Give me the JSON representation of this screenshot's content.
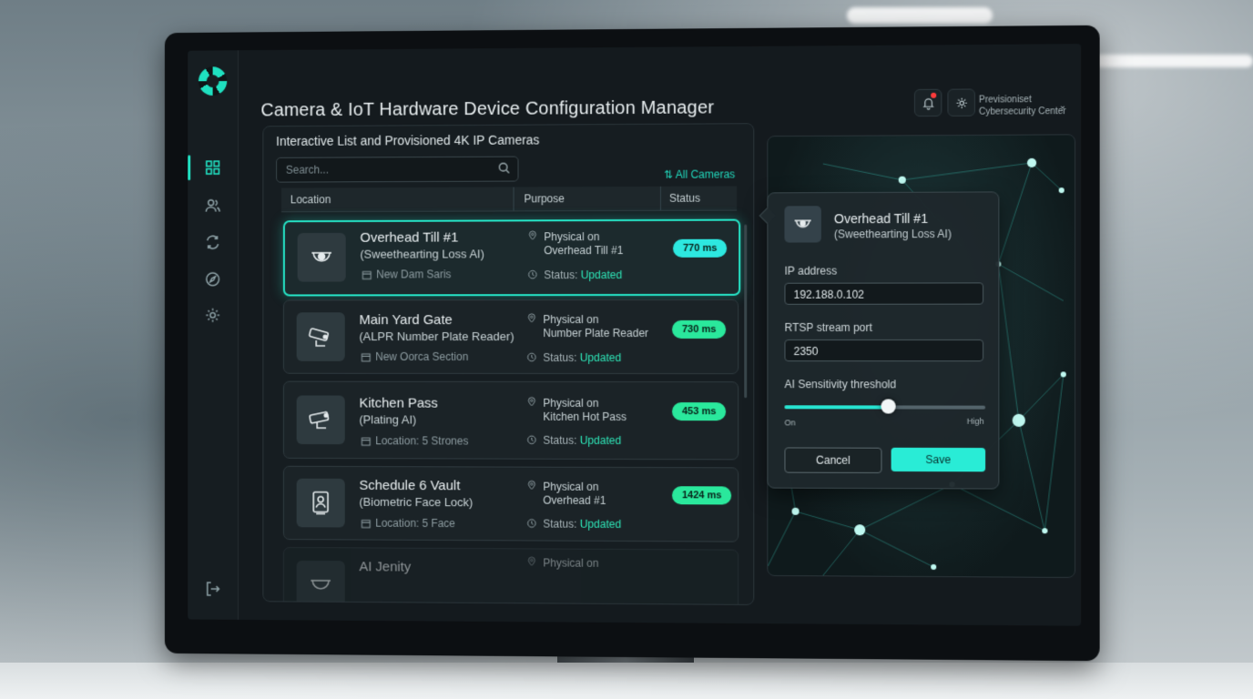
{
  "app": {
    "title": "Camera & IoT Hardware Device Configuration Manager",
    "user_name": "Previsioniset",
    "user_org": "Cybersecurity Center"
  },
  "list": {
    "title": "Interactive List and Provisioned 4K IP Cameras",
    "search_placeholder": "Search...",
    "filter_label": "All Cameras",
    "columns": [
      "Location",
      "Purpose",
      "Status"
    ],
    "rows": [
      {
        "name": "Overhead Till #1",
        "sub": "(Sweethearting Loss AI)",
        "loc": "New Dam Saris",
        "purpose1": "Physical on",
        "purpose2": "Overhead Till #1",
        "status_label": "Status:",
        "status_value": "Updated",
        "latency": "770 ms",
        "icon": "dome-camera-icon"
      },
      {
        "name": "Main Yard Gate",
        "sub": "(ALPR Number Plate Reader)",
        "loc": "New Oorca Section",
        "purpose1": "Physical on",
        "purpose2": "Number Plate Reader",
        "status_label": "Status:",
        "status_value": "Updated",
        "latency": "730 ms",
        "icon": "bullet-camera-icon"
      },
      {
        "name": "Kitchen Pass",
        "sub": "(Plating AI)",
        "loc": "Location: 5 Strones",
        "purpose1": "Physical on",
        "purpose2": "Kitchen Hot Pass",
        "status_label": "Status:",
        "status_value": "Updated",
        "latency": "453 ms",
        "icon": "bullet-camera-icon"
      },
      {
        "name": "Schedule 6 Vault",
        "sub": "(Biometric Face Lock)",
        "loc": "Location: 5 Face",
        "purpose1": "Physical on",
        "purpose2": "Overhead #1",
        "status_label": "Status:",
        "status_value": "Updated",
        "latency": "1424 ms",
        "icon": "face-lock-icon"
      },
      {
        "name": "AI Jenity",
        "purpose1": "Physical on",
        "icon": "dome-camera-icon"
      }
    ]
  },
  "detail": {
    "name": "Overhead Till #1",
    "sub": "(Sweethearting Loss AI)",
    "ip_label": "IP address",
    "ip_value": "192.188.0.102",
    "rtsp_label": "RTSP stream port",
    "rtsp_value": "2350",
    "slider_label": "AI Sensitivity threshold",
    "slider_min": "On",
    "slider_max": "High",
    "slider_value": 0.52,
    "cancel_label": "Cancel",
    "save_label": "Save"
  },
  "colors": {
    "accent": "#21e3c4",
    "badge_green": "#2ae89c",
    "badge_cyan": "#2de8e0"
  }
}
